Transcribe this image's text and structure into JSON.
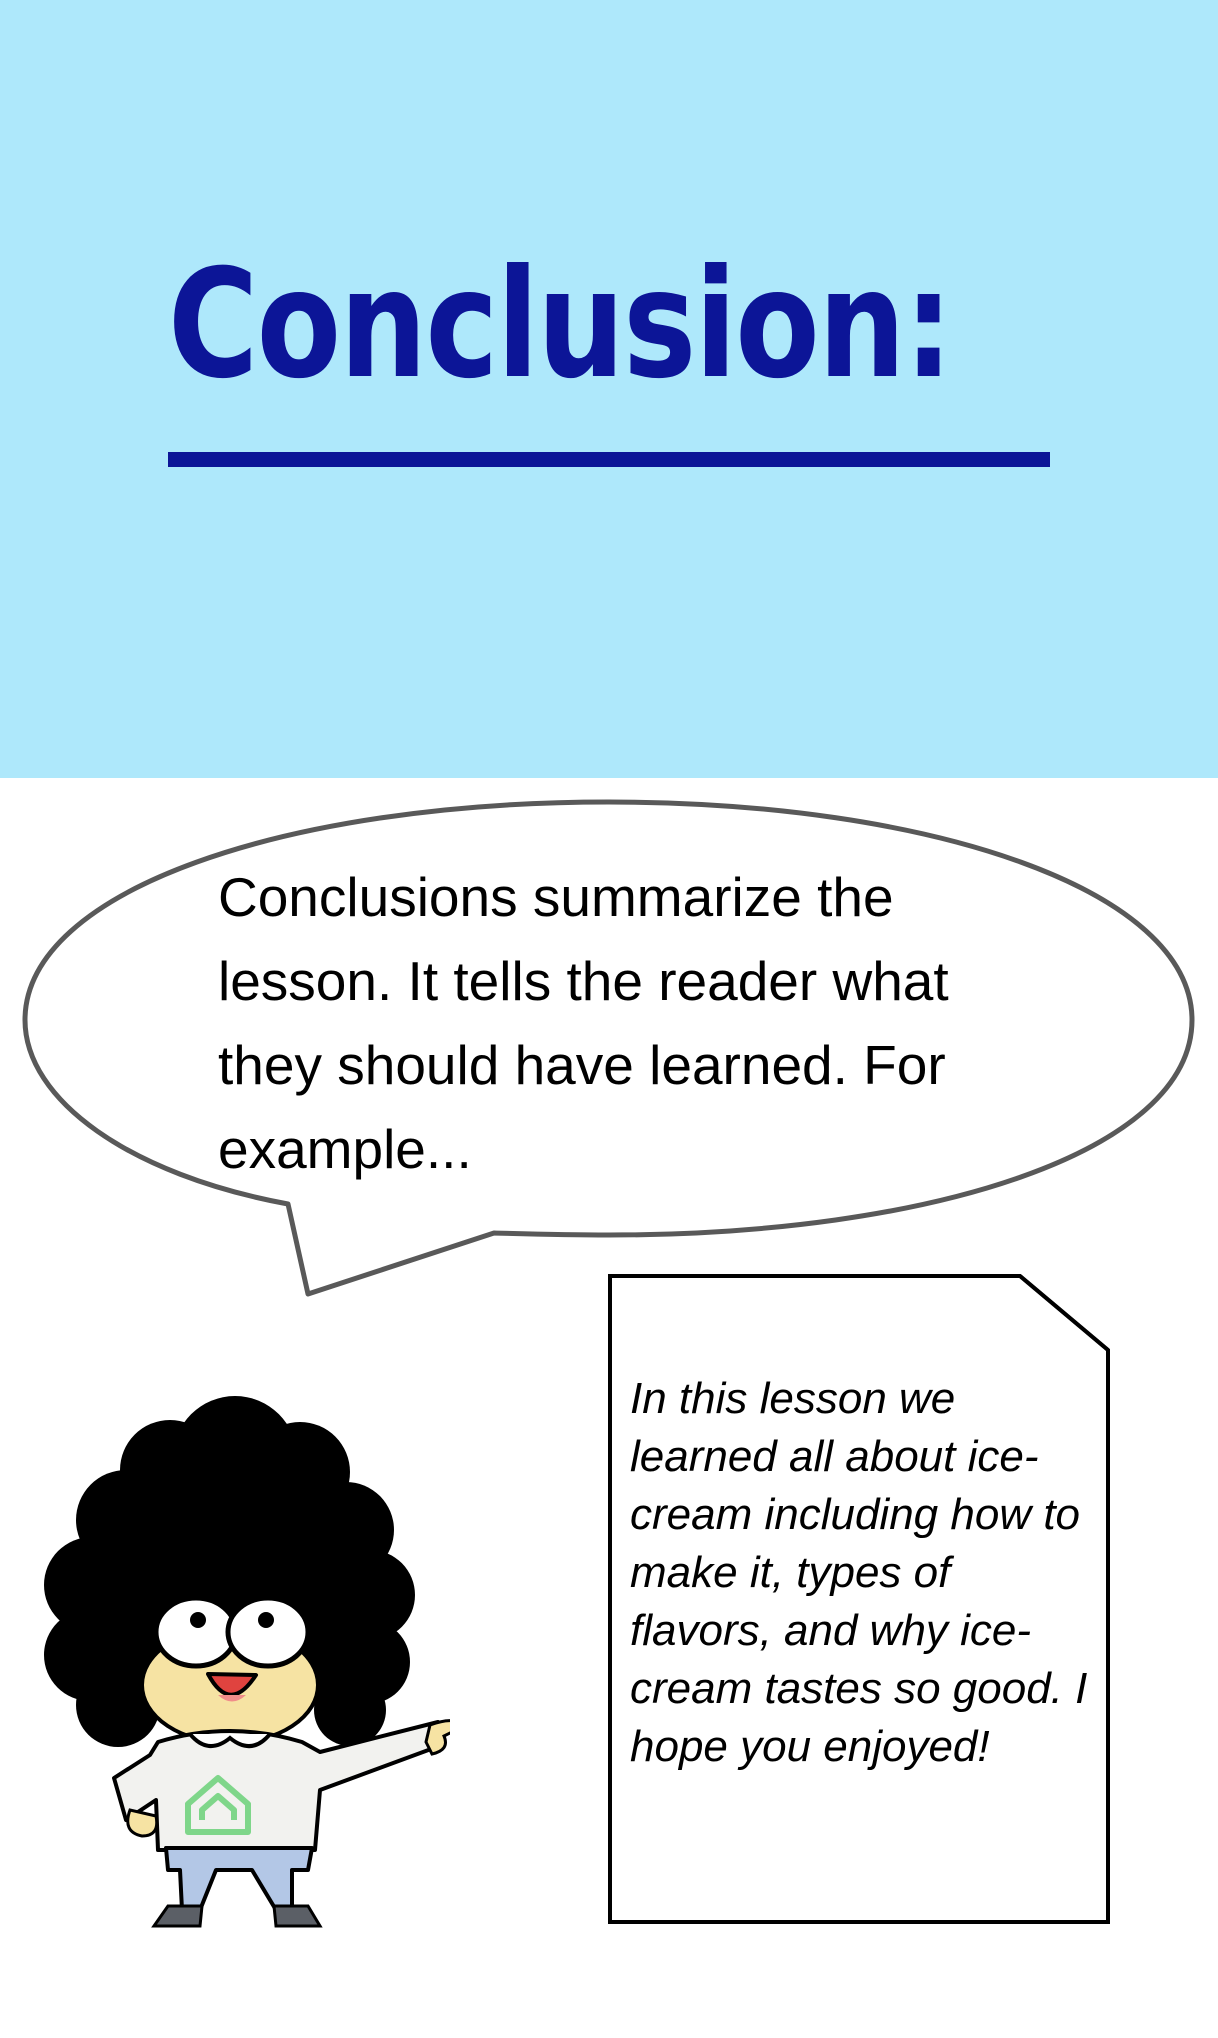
{
  "slide": {
    "title": "Conclusion:",
    "speech_bubble_text": "Conclusions summarize the lesson. It tells the reader what they should have learned. For example...",
    "note_text": "In this lesson we learned all about ice-cream including how to make it, types of flavors, and why ice-cream tastes so good. I hope you enjoyed!"
  },
  "colors": {
    "title_band": "#aee8fb",
    "title_text": "#0c1597",
    "bubble_outline": "#595959",
    "shirt_logo": "#7fd68a"
  },
  "icons": {
    "character": "cartoon-girl-pointing-illustration",
    "shirt_logo": "house-logo-icon"
  }
}
